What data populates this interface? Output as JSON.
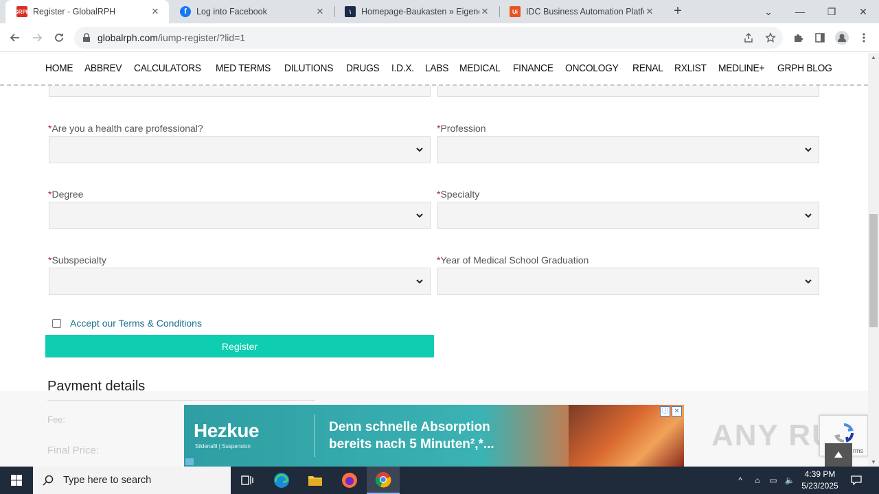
{
  "browser": {
    "tabs": [
      {
        "title": "Register - GlobalRPH",
        "favicon": "grph-icon",
        "active": true
      },
      {
        "title": "Log into Facebook",
        "favicon": "facebook-icon",
        "active": false
      },
      {
        "title": "Homepage-Baukasten » Eigene",
        "favicon": "baukasten-icon",
        "active": false
      },
      {
        "title": "IDC Business Automation Platfor",
        "favicon": "uipath-icon",
        "active": false
      }
    ],
    "url_host": "globalrph.com",
    "url_path": "/iump-register/?lid=1"
  },
  "sitenav": {
    "items": [
      "HOME",
      "ABBREV",
      "CALCULATORS",
      "MED TERMS",
      "DILUTIONS",
      "DRUGS",
      "I.D.X.",
      "LABS",
      "MEDICAL",
      "FINANCE",
      "ONCOLOGY",
      "RENAL",
      "RXLIST",
      "MEDLINE+",
      "GRPH BLOG"
    ]
  },
  "form": {
    "required_mark": "*",
    "fields": {
      "hcp": "Are you a health care professional?",
      "profession": "Profession",
      "degree": "Degree",
      "specialty": "Specialty",
      "subspecialty": "Subspecialty",
      "grad_year": "Year of Medical School Graduation"
    },
    "terms_label": "Accept our Terms & Conditions",
    "register_label": "Register",
    "payment_heading": "Payment details",
    "fee_label": "Fee:",
    "final_price_label": "Final Price:"
  },
  "ad": {
    "brand": "Hezkue",
    "brand_sub": "Sildenafil | Suspension",
    "line1": "Denn schnelle Absorption",
    "line2": "bereits nach 5 Minuten²,*..."
  },
  "overlay": {
    "watermark": "ANY RUN",
    "recaptcha_text": "rms"
  },
  "taskbar": {
    "search_placeholder": "Type here to search",
    "time": "4:39 PM",
    "date": "5/23/2025"
  },
  "colors": {
    "register_button": "#0fcdb0",
    "required": "#c0262c",
    "link": "#1a6d8e"
  }
}
